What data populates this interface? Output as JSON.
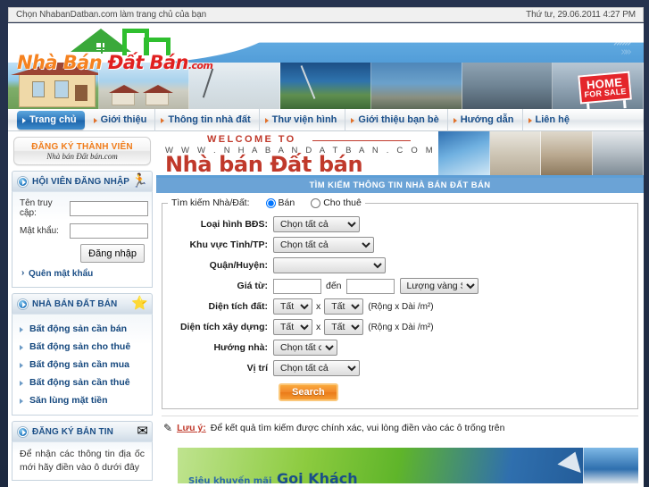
{
  "topbar": {
    "homepage_text": "Chọn NhabanDatban.com làm trang chủ của bạn",
    "datetime": "Thứ tư, 29.06.2011 4:27 PM"
  },
  "header": {
    "logo_part1": "Nhà Bán ",
    "logo_part2": "Đất Bán",
    "logo_tld": ".com",
    "sign_line1": "HOME",
    "sign_line2": "FOR SALE"
  },
  "nav": {
    "items": [
      {
        "label": "Trang chủ",
        "active": true
      },
      {
        "label": "Giới thiệu",
        "active": false
      },
      {
        "label": "Thông tin nhà đất",
        "active": false
      },
      {
        "label": "Thư viện hình",
        "active": false
      },
      {
        "label": "Giới thiệu bạn bè",
        "active": false
      },
      {
        "label": "Hướng dẫn",
        "active": false
      },
      {
        "label": "Liên hệ",
        "active": false
      }
    ]
  },
  "sidebar": {
    "register": {
      "title": "ĐĂNG KÝ THÀNH VIÊN",
      "subtitle": "Nhà bán Đất bán.com"
    },
    "login_panel": {
      "title": "HỘI VIÊN ĐĂNG NHẬP",
      "icon": "runner-icon",
      "username_label": "Tên truy cập:",
      "username_value": "",
      "password_label": "Mật khẩu:",
      "password_value": "",
      "login_button": "Đăng nhập",
      "forgot_link": "Quên mật khẩu"
    },
    "listings_panel": {
      "title": "NHÀ BÁN ĐẤT BÁN",
      "icon": "star-icon",
      "items": [
        "Bất động sản cần bán",
        "Bất động sản cho thuê",
        "Bất động sản cần mua",
        "Bất động sản cần thuê",
        "Săn lùng mặt tiền"
      ]
    },
    "newsletter_panel": {
      "title": "ĐĂNG KÝ BẢN TIN",
      "icon": "envelope-icon",
      "text": "Để nhận các thông tin địa ốc mới hãy điền vào ô dưới đây"
    }
  },
  "main": {
    "welcome": {
      "line1": "WELCOME TO",
      "line2": "W W W . N H A B A N D A T B A N . C O M",
      "line3": "Nhà bán Đất bán"
    },
    "section_title": "TÌM KIẾM THÔNG TIN NHÀ BÁN ĐẤT BÁN",
    "search_form": {
      "legend": "Tìm kiếm Nhà/Đất:",
      "radio_sell": "Bán",
      "radio_rent": "Cho thuê",
      "selected_radio": "Bán",
      "fields": [
        {
          "label": "Loại hình BĐS:",
          "value": "Chọn tất cả"
        },
        {
          "label": "Khu vực Tỉnh/TP:",
          "value": "Chọn tất cả"
        },
        {
          "label": "Quận/Huyện:",
          "value": ""
        }
      ],
      "price": {
        "label": "Giá từ:",
        "from_value": "",
        "to_label": "đến",
        "to_value": "",
        "unit_value": "Lượng vàng S."
      },
      "land_area": {
        "label": "Diện tích đất:",
        "width_value": "Tất cả",
        "x": "x",
        "length_value": "Tất cả",
        "unit": "(Rộng x Dài /m²)"
      },
      "build_area": {
        "label": "Diện tích xây dựng:",
        "width_value": "Tất cả",
        "x": "x",
        "length_value": "Tất cả",
        "unit": "(Rộng x Dài /m²)"
      },
      "direction": {
        "label": "Hướng nhà:",
        "value": "Chọn tất cả"
      },
      "position": {
        "label": "Vị trí",
        "value": "Chọn tất cả"
      },
      "search_button": "Search"
    },
    "note": {
      "icon": "pencil-icon",
      "link": "Lưu ý:",
      "text": "Để kết quả tìm kiếm được chính xác, vui lòng điền vào các ô trống trên"
    },
    "promo": {
      "prefix": "Siêu khuyến mãi",
      "title": "Gọi Khách"
    }
  },
  "colors": {
    "accent_blue": "#1b4e86",
    "nav_active": "#2d77bb",
    "orange": "#f07c1a",
    "red": "#c0392b",
    "section_blue": "#6ba3d6",
    "page_bg": "#1e2a44"
  }
}
